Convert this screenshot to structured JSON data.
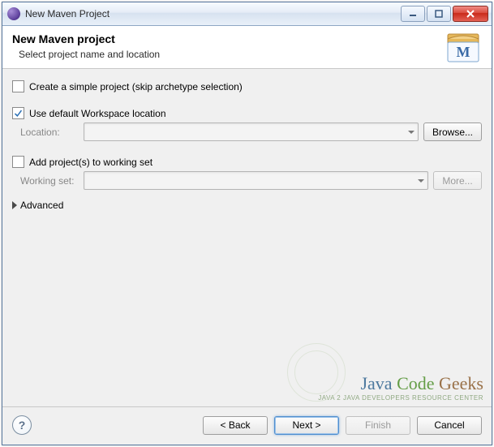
{
  "titlebar": {
    "title": "New Maven Project"
  },
  "banner": {
    "heading": "New Maven project",
    "subtitle": "Select project name and location"
  },
  "form": {
    "simple_project_label": "Create a simple project (skip archetype selection)",
    "use_default_workspace_label": "Use default Workspace location",
    "location_label": "Location:",
    "location_value": "",
    "browse_label": "Browse...",
    "add_to_working_set_label": "Add project(s) to working set",
    "working_set_label": "Working set:",
    "working_set_value": "",
    "more_label": "More...",
    "advanced_label": "Advanced"
  },
  "footer": {
    "back_label": "< Back",
    "next_label": "Next >",
    "finish_label": "Finish",
    "cancel_label": "Cancel"
  },
  "watermark": {
    "title_java": "Java",
    "title_code": "Code",
    "title_geeks": "Geeks",
    "subtitle": "JAVA 2 JAVA DEVELOPERS RESOURCE CENTER"
  }
}
